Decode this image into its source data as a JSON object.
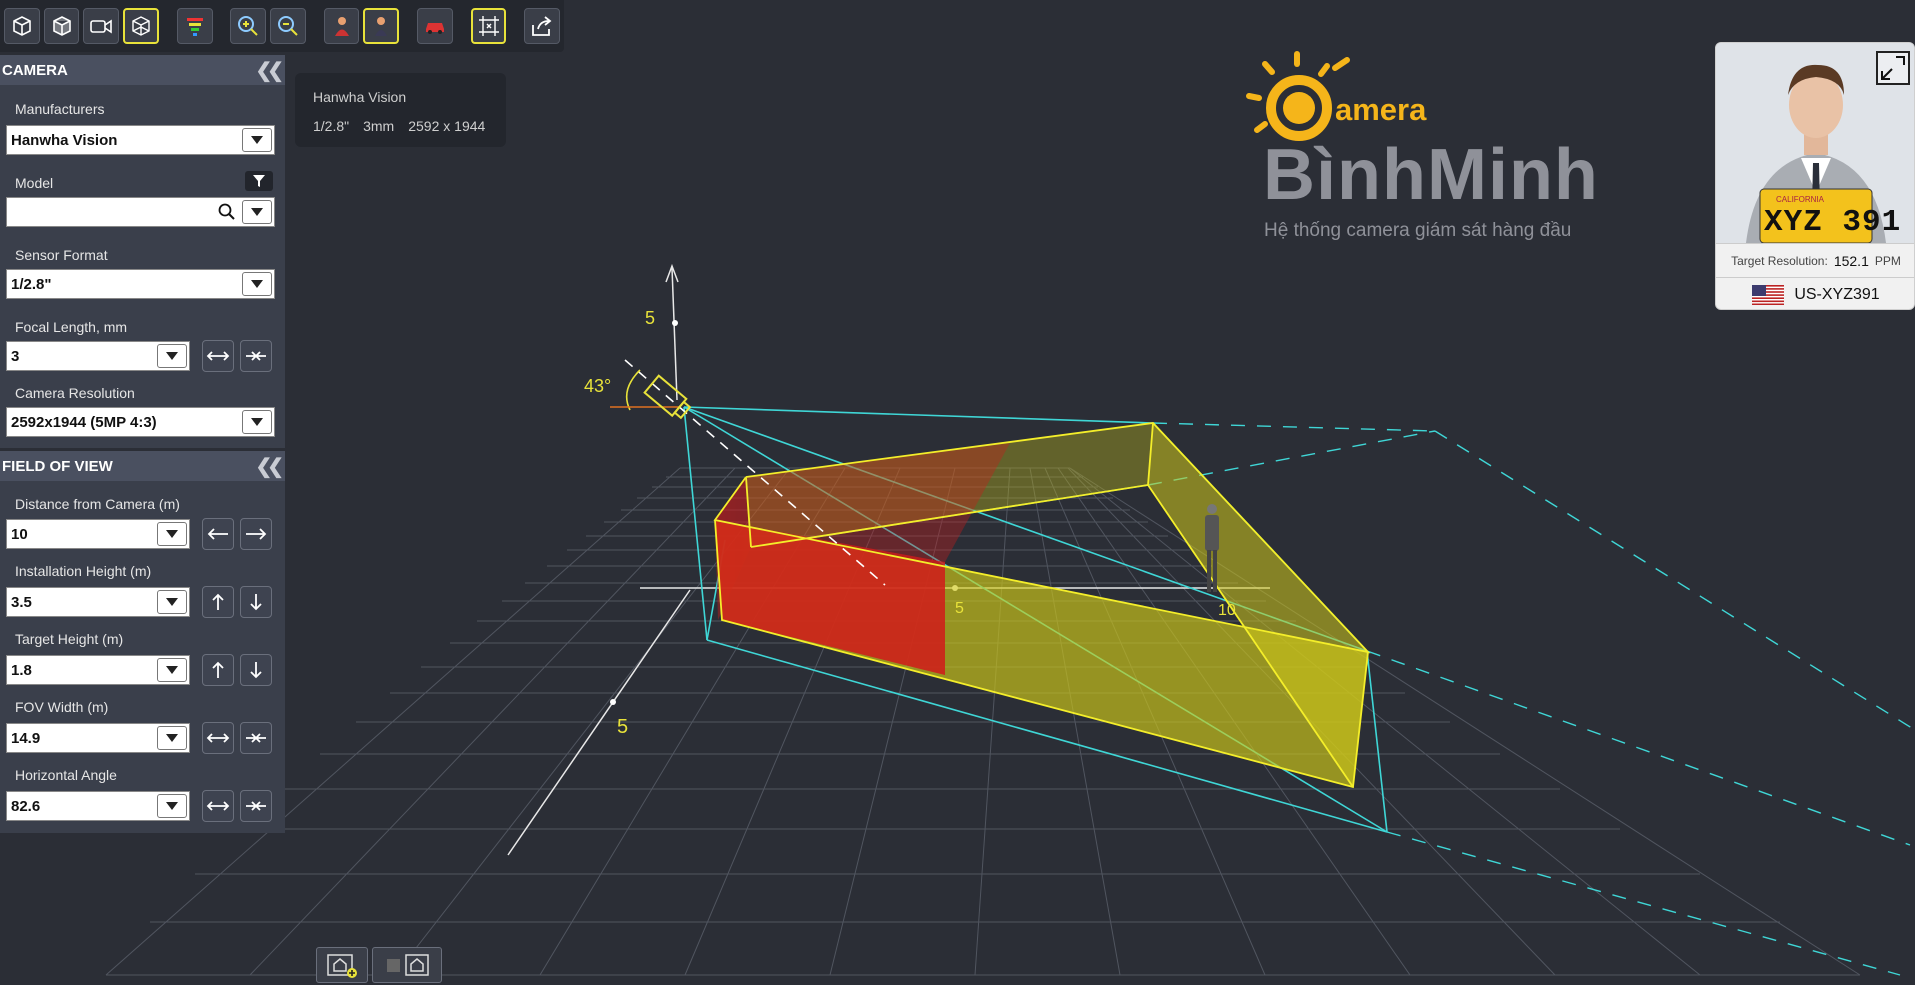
{
  "toolbar": {
    "buttons": [
      {
        "icon": "cube-front-icon",
        "active": false
      },
      {
        "icon": "cube-side-icon",
        "active": false
      },
      {
        "icon": "video-camera-icon",
        "active": false
      },
      {
        "icon": "wireframe-cube-icon",
        "active": true
      },
      {
        "icon": "color-filter-icon",
        "active": false
      },
      {
        "icon": "zoom-in-icon",
        "active": false
      },
      {
        "icon": "zoom-out-icon",
        "active": false
      },
      {
        "icon": "person-female-icon",
        "active": false
      },
      {
        "icon": "person-male-icon",
        "active": true
      },
      {
        "icon": "car-icon",
        "active": false
      },
      {
        "icon": "grid-frame-icon",
        "active": true
      },
      {
        "icon": "share-export-icon",
        "active": false
      }
    ]
  },
  "camera_panel": {
    "title": "CAMERA",
    "manufacturers_label": "Manufacturers",
    "manufacturer_value": "Hanwha Vision",
    "model_label": "Model",
    "model_value": "",
    "sensor_label": "Sensor Format",
    "sensor_value": "1/2.8\"",
    "focal_label": "Focal Length, mm",
    "focal_value": "3",
    "resolution_label": "Camera Resolution",
    "resolution_value": "2592x1944 (5MP 4:3)"
  },
  "fov_panel": {
    "title": "FIELD OF VIEW",
    "distance_label": "Distance from Camera (m)",
    "distance_value": "10",
    "height_label": "Installation Height (m)",
    "height_value": "3.5",
    "target_label": "Target Height (m)",
    "target_value": "1.8",
    "width_label": "FOV Width (m)",
    "width_value": "14.9",
    "angle_label": "Horizontal Angle",
    "angle_value": "82.6"
  },
  "info_card": {
    "manufacturer": "Hanwha Vision",
    "sensor": "1/2.8\"",
    "focal": "3mm",
    "resolution": "2592 x 1944"
  },
  "logo": {
    "camera_word": "amera",
    "brand": "BìnhMinh",
    "tagline": "Hệ thống camera giám sát hàng đầu"
  },
  "scene": {
    "tilt_angle": "43°",
    "axis_label_vertical": "5",
    "axis_label_depth": "5",
    "axis_label_x5": "5",
    "axis_label_x10": "10"
  },
  "preview": {
    "plate_top": "CALIFORNIA",
    "plate_text": "XYZ 391",
    "resolution_label": "Target Resolution:",
    "resolution_value": "152.1",
    "resolution_unit": "PPM",
    "plate_id": "US-XYZ391"
  },
  "colors": {
    "accent_yellow": "#e8e23a",
    "fov_cyan": "#3fd6d6",
    "danger_red": "#d11a1a",
    "logo_orange": "#f5b51a"
  }
}
